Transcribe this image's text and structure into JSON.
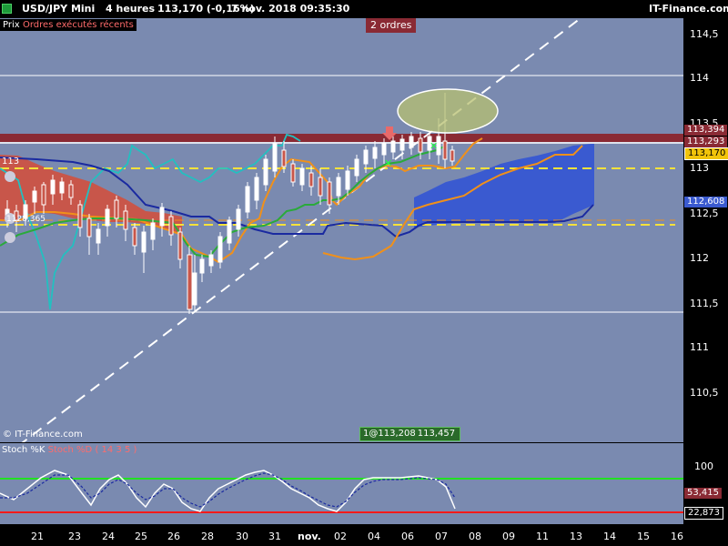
{
  "header": {
    "instrument": "USD/JPY Mini",
    "timeframe": "4 heures",
    "quote": "113,170 (-0,16%)",
    "datetime": "7 nov. 2018 09:35:30",
    "site": "IT-Finance.com"
  },
  "tabs": {
    "price": "Prix",
    "recent_orders": "Ordres exécutés récents"
  },
  "orders_badge": "2 ordres",
  "copyright": "© IT-Finance.com",
  "order_box": {
    "qty": "1@113,208",
    "target": "113,457"
  },
  "left_labels": {
    "level": "113",
    "small": "1128,365"
  },
  "y_axis": {
    "labels": [
      "114,5",
      "114",
      "113,5",
      "113",
      "112,5",
      "112",
      "111,5",
      "111",
      "110,5"
    ]
  },
  "price_tags": {
    "upper": "113,394",
    "mid": "113,293",
    "last": "113,170",
    "cloud": "112,608"
  },
  "x_axis": {
    "labels": [
      "21",
      "23",
      "24",
      "25",
      "26",
      "28",
      "30",
      "31",
      "nov.",
      "02",
      "04",
      "06",
      "07",
      "08",
      "09",
      "11",
      "13",
      "14",
      "15",
      "16"
    ]
  },
  "oscillator": {
    "title_k": "Stoch %K",
    "title_d": "Stoch %D ( 14 3 5 )",
    "level_100": "100",
    "value_d": "53,415",
    "value_k": "22,873"
  },
  "colors": {
    "panel_bg": "#7a8ab0",
    "band_red": "#8a2a34",
    "kumo_red": "#c8564a",
    "kumo_blue": "#3a5ad0",
    "tenkan": "#1a2aa0",
    "kijun": "#f0901a",
    "chikou": "#22c0c0",
    "ma_green": "#2aaa3a",
    "dash_yellow": "#f6e23a",
    "trend_white": "#ffffff"
  }
}
